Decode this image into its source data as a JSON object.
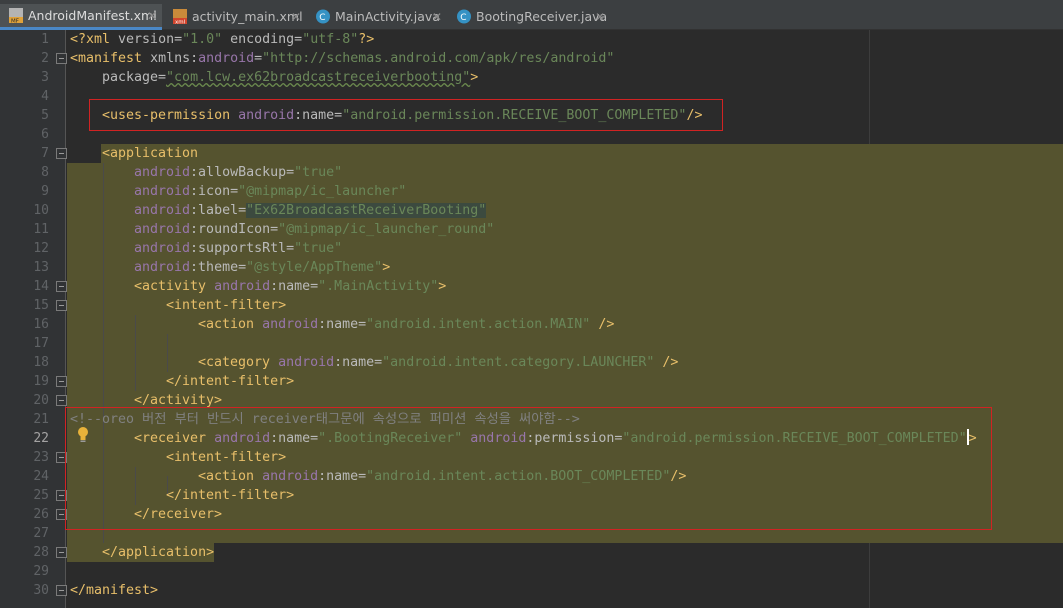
{
  "tabs": [
    {
      "label": "AndroidManifest.xml",
      "icon": "xml-manifest-icon",
      "active": true
    },
    {
      "label": "activity_main.xml",
      "icon": "xml-layout-icon",
      "active": false
    },
    {
      "label": "MainActivity.java",
      "icon": "java-class-icon",
      "active": false
    },
    {
      "label": "BootingReceiver.java",
      "icon": "java-class-icon",
      "active": false
    }
  ],
  "editor": {
    "current_line": 22,
    "line_numbers": [
      "1",
      "2",
      "3",
      "4",
      "5",
      "6",
      "7",
      "8",
      "9",
      "10",
      "11",
      "12",
      "13",
      "14",
      "15",
      "16",
      "17",
      "18",
      "19",
      "20",
      "21",
      "22",
      "23",
      "24",
      "25",
      "26",
      "27",
      "28",
      "29",
      "30"
    ],
    "code": {
      "l1_open": "<?xml",
      "l1_version_attr": " version=",
      "l1_version_val": "\"1.0\"",
      "l1_enc_attr": " encoding=",
      "l1_enc_val": "\"utf-8\"",
      "l1_close": "?>",
      "l2_tag": "<manifest",
      "l2_xmlns": " xmlns:",
      "l2_ns": "android",
      "l2_eq": "=",
      "l2_val": "\"http://schemas.android.com/apk/res/android\"",
      "l3_attr": "package=",
      "l3_val": "\"com.lcw.ex62broadcastreceiverbooting\"",
      "l3_close": ">",
      "l5_tag": "<uses-permission",
      "l5_ns": "android",
      "l5_attr": ":name=",
      "l5_val": "\"android.permission.RECEIVE_BOOT_COMPLETED\"",
      "l5_close": "/>",
      "l7_tag": "<application",
      "l8_attr": ":allowBackup=",
      "l8_val": "\"true\"",
      "l9_attr": ":icon=",
      "l9_val": "\"@mipmap/ic_launcher\"",
      "l10_attr": ":label=",
      "l10_val": "\"Ex62BroadcastReceiverBooting\"",
      "l11_attr": ":roundIcon=",
      "l11_val": "\"@mipmap/ic_launcher_round\"",
      "l12_attr": ":supportsRtl=",
      "l12_val": "\"true\"",
      "l13_attr": ":theme=",
      "l13_val": "\"@style/AppTheme\"",
      "l13_close": ">",
      "ns": "android",
      "l14_tag": "<activity",
      "l14_attr": ":name=",
      "l14_val": "\".MainActivity\"",
      "l14_close": ">",
      "l15_tag": "<intent-filter>",
      "l16_tag": "<action",
      "l16_attr": ":name=",
      "l16_val": "\"android.intent.action.MAIN\"",
      "l16_close": " />",
      "l18_tag": "<category",
      "l18_attr": ":name=",
      "l18_val": "\"android.intent.category.LAUNCHER\"",
      "l18_close": " />",
      "l19_tag": "</intent-filter>",
      "l20_tag": "</activity>",
      "l21_comment": "<!--oreo 버전 부터 반드시 receiver태그문에 속성으로 퍼미션 속성을 써야함-->",
      "l22_tag": "<receiver",
      "l22_attr1": ":name=",
      "l22_val1": "\".BootingReceiver\"",
      "l22_attr2": ":permission=",
      "l22_val2": "\"android.permission.RECEIVE_BOOT_COMPLETED\"",
      "l22_close": ">",
      "l23_tag": "<intent-filter>",
      "l24_tag": "<action",
      "l24_attr": ":name=",
      "l24_val": "\"android.intent.action.BOOT_COMPLETED\"",
      "l24_close": "/>",
      "l25_tag": "</intent-filter>",
      "l26_tag": "</receiver>",
      "l28_tag": "</application>",
      "l30_tag": "</manifest>"
    }
  },
  "colors": {
    "background": "#2b2b2b",
    "tag": "#e8bf6a",
    "attribute_namespace": "#9876aa",
    "string_value": "#6a8759",
    "comment": "#808080",
    "selection": "#55532f",
    "annotation_box": "#d12323"
  }
}
